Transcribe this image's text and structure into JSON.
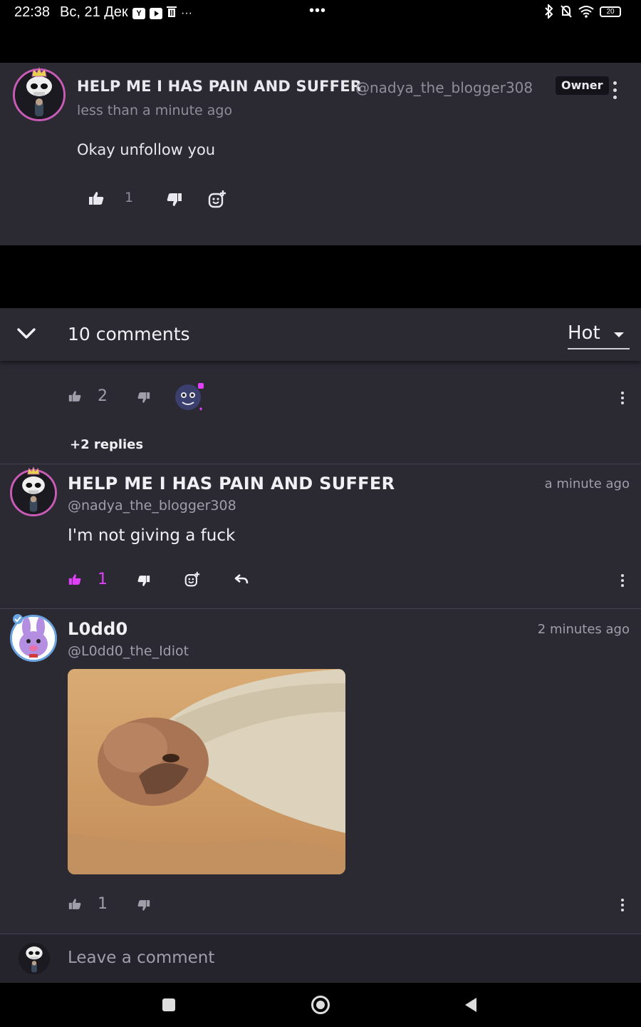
{
  "status_bar": {
    "time": "22:38",
    "date": "Вс, 21 Дек",
    "app_icons": [
      "Y",
      "▶",
      "🗑"
    ],
    "more": "···",
    "center_dots": "•••",
    "battery": "20"
  },
  "pinned_comment": {
    "author_name": "HELP ME I HAS PAIN AND SUFFER",
    "author_handle": "@nadya_the_blogger308",
    "timestamp": "less than a minute ago",
    "badge": "Owner",
    "body": "Okay unfollow you",
    "like_count": "1",
    "avatar_ring_color": "#c75bb5"
  },
  "comments_section": {
    "count_label": "10 comments",
    "sort": {
      "selected": "Hot"
    },
    "first_comment_partial": {
      "like_count": "2",
      "replies_label": "+2 replies"
    },
    "comments": [
      {
        "author_name": "HELP ME I HAS PAIN AND SUFFER",
        "author_handle": "@nadya_the_blogger308",
        "timestamp": "a minute ago",
        "body": "I'm not giving a fuck",
        "like_count": "1",
        "liked": true
      },
      {
        "author_name": "L0dd0",
        "author_handle": "@L0dd0_the_Idiot",
        "timestamp": "2 minutes ago",
        "attachment": "gif-image",
        "like_count": "1",
        "liked": false
      }
    ]
  },
  "comment_input": {
    "placeholder": "Leave a comment"
  },
  "colors": {
    "background": "#2b2a33",
    "accent_pink": "#e040fb",
    "muted_text": "#a09eaa"
  }
}
